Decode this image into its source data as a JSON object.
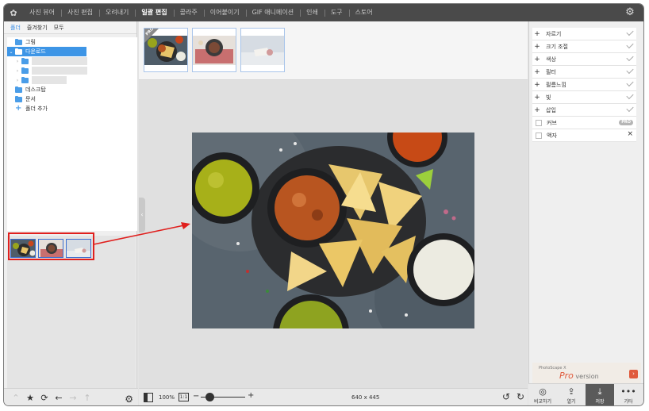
{
  "app": {
    "logo_glyph": "✿"
  },
  "menu": {
    "items": [
      "사진 뷰어",
      "사진 편집",
      "오려내기",
      "일괄 편집",
      "콜라주",
      "이어붙이기",
      "GIF 애니메이션",
      "인쇄",
      "도구",
      "스토어"
    ],
    "active": "일괄 편집",
    "settings_icon": "gear-icon"
  },
  "left_panel": {
    "tabs": [
      "폴더",
      "즐겨찾기",
      "모두"
    ],
    "active_tab": "폴더",
    "tree": {
      "pictures": "그림",
      "downloads": "다운로드",
      "desktop": "데스크탑",
      "documents": "문서",
      "add_folder": "폴더 추가"
    }
  },
  "center": {
    "zoom": "100%",
    "ratio_label": "1:1",
    "minus": "−",
    "plus": "+",
    "dimensions": "640 x 445",
    "pro_badge": "PRO"
  },
  "right_panel": {
    "adjustments": [
      "자르기",
      "크기 조절",
      "색상",
      "필터",
      "필름느낌",
      "빛",
      "삽입"
    ],
    "options": [
      {
        "label": "커브",
        "badge": "PRO"
      },
      {
        "label": "액자",
        "badge": "×"
      }
    ],
    "ad": {
      "small": "PhotoScape X",
      "pro": "Pro",
      "version": " version",
      "badge": "›"
    },
    "toolbar": {
      "compare": "비교하기",
      "open": "열기",
      "save": "저장",
      "more": "기타"
    }
  },
  "colors": {
    "menubar": "#4a4a4a",
    "selection": "#3d95e6",
    "annotation": "#e0201e"
  }
}
